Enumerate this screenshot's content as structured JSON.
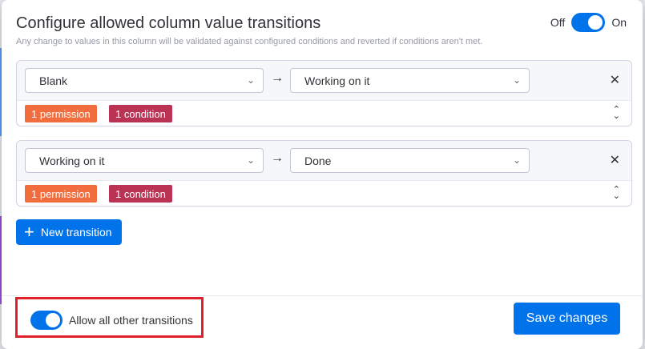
{
  "header": {
    "title": "Configure allowed column value transitions",
    "subtitle": "Any change to values in this column will be validated against configured conditions and reverted if conditions aren't met.",
    "toggle_off_label": "Off",
    "toggle_on_label": "On",
    "toggle_state": "on"
  },
  "transitions": [
    {
      "from": "Blank",
      "to": "Working on it",
      "permission_badge": "1 permission",
      "condition_badge": "1 condition"
    },
    {
      "from": "Working on it",
      "to": "Done",
      "permission_badge": "1 permission",
      "condition_badge": "1 condition"
    }
  ],
  "new_transition_label": "New transition",
  "footer": {
    "allow_label": "Allow all other transitions",
    "allow_state": "on",
    "save_label": "Save changes"
  },
  "colors": {
    "accent": "#0073ea",
    "permission_badge": "#f26d3d",
    "condition_badge": "#bb3354",
    "highlight": "#e2202a"
  },
  "icons": {
    "arrow": "arrow-right-icon",
    "close": "close-icon",
    "chevron": "chevron-down-icon",
    "expand": "up-down-icon",
    "plus": "plus-icon"
  }
}
